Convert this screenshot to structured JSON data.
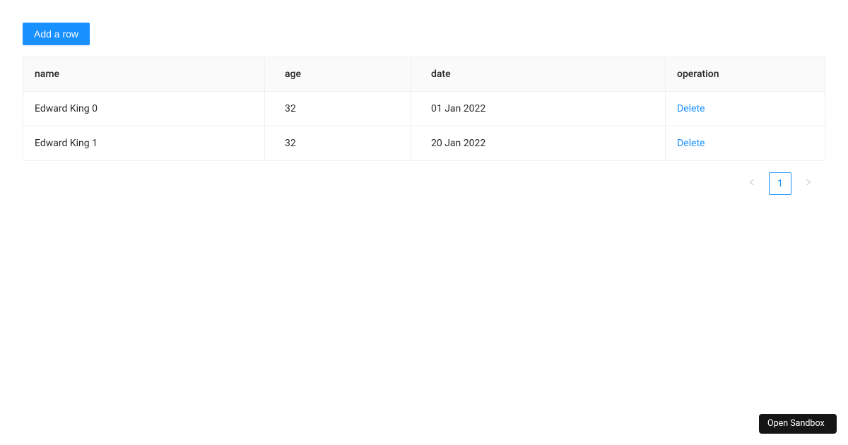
{
  "toolbar": {
    "add_row_label": "Add a row"
  },
  "table": {
    "columns": {
      "name": "name",
      "age": "age",
      "date": "date",
      "operation": "operation"
    },
    "rows": [
      {
        "name": "Edward King 0",
        "age": "32",
        "date": "01 Jan 2022",
        "operation": "Delete"
      },
      {
        "name": "Edward King 1",
        "age": "32",
        "date": "20 Jan 2022",
        "operation": "Delete"
      }
    ]
  },
  "pagination": {
    "current_page": "1"
  },
  "sandbox": {
    "open_label": "Open Sandbox"
  }
}
